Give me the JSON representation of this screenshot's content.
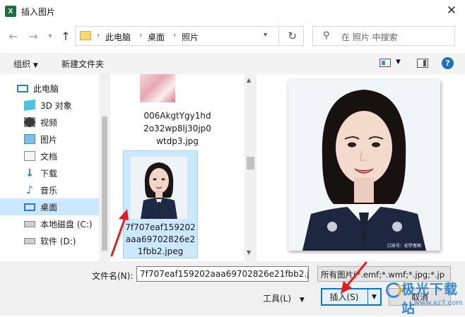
{
  "window": {
    "title": "插入图片",
    "app_icon_letter": "X"
  },
  "nav": {
    "breadcrumb": [
      "此电脑",
      "桌面",
      "照片"
    ],
    "search_placeholder": "在 照片 中搜索"
  },
  "toolbar": {
    "organize_label": "组织",
    "new_folder_label": "新建文件夹"
  },
  "sidebar": {
    "items": [
      {
        "label": "此电脑",
        "icon": "computer-icon"
      },
      {
        "label": "3D 对象",
        "icon": "cube-icon"
      },
      {
        "label": "视频",
        "icon": "video-icon"
      },
      {
        "label": "图片",
        "icon": "picture-icon"
      },
      {
        "label": "文档",
        "icon": "document-icon"
      },
      {
        "label": "下载",
        "icon": "download-icon"
      },
      {
        "label": "音乐",
        "icon": "music-icon"
      },
      {
        "label": "桌面",
        "icon": "desktop-icon"
      },
      {
        "label": "本地磁盘 (C:)",
        "icon": "drive-icon"
      },
      {
        "label": "软件 (D:)",
        "icon": "drive-icon"
      }
    ],
    "selected": "桌面"
  },
  "files": [
    {
      "name_lines": [
        "006AkgtYgy1hd",
        "2o32wp8lj30jp0",
        "wtdp3.jpg"
      ],
      "selected": false
    },
    {
      "name_lines": [
        "7f707eaf159202",
        "aaa69702826e2",
        "1fbb2.jpeg"
      ],
      "selected": true
    }
  ],
  "preview": {
    "watermark": "口采号：初学者图"
  },
  "footer": {
    "filename_label": "文件名(N):",
    "filename_value": "7f707eaf159202aaa69702826e21fbb2.j",
    "filter_value": "所有图片(*.emf;*.wmf;*.jpg;*.jp",
    "tools_label": "工具(L)",
    "insert_label": "插入(S)",
    "cancel_label": "取消"
  },
  "brand_watermark": {
    "text": "极光下载站",
    "url": "www.xz7.com"
  },
  "colors": {
    "selection": "#cce8ff",
    "accent": "#0078d7",
    "arrow": "#e02020"
  }
}
